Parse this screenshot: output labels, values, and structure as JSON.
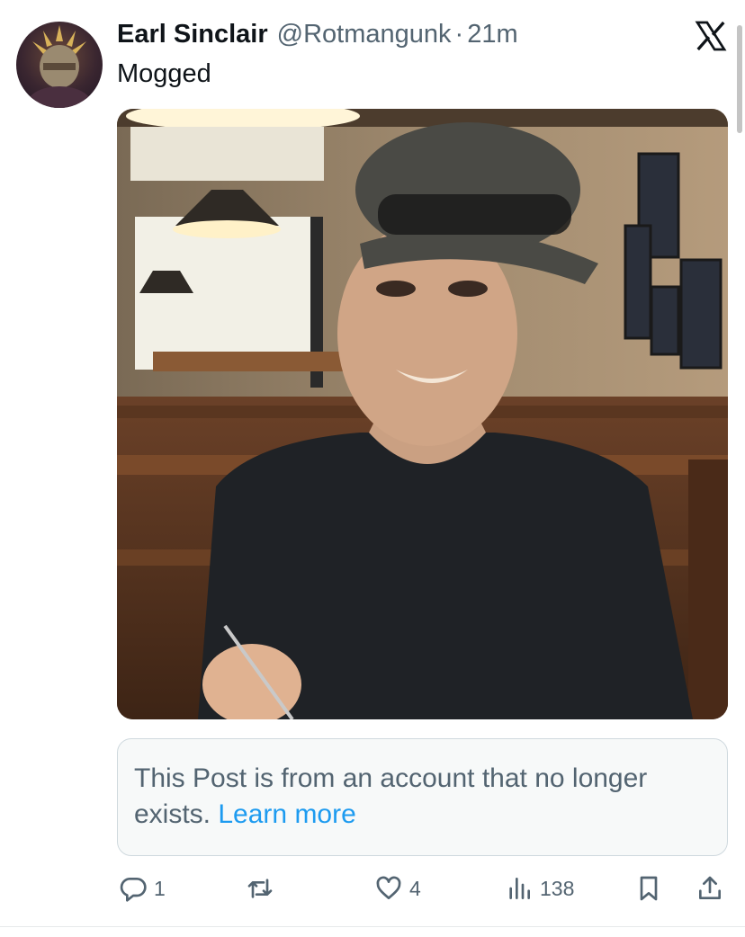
{
  "post": {
    "display_name": "Earl Sinclair",
    "handle": "@Rotmangunk",
    "separator": "·",
    "time": "21m",
    "text": "Mogged",
    "platform_icon": "x-logo-icon",
    "avatar_icon": "roman-helmet-avatar"
  },
  "notice": {
    "text": "This Post is from an account that no longer exists.",
    "link": "Learn more"
  },
  "actions": {
    "reply_count": "1",
    "repost_count": "",
    "like_count": "4",
    "views_count": "138",
    "icons": [
      "reply-icon",
      "repost-icon",
      "like-icon",
      "views-icon",
      "bookmark-icon",
      "share-icon"
    ]
  },
  "colors": {
    "text_primary": "#0f1419",
    "text_secondary": "#536471",
    "link": "#1d9bf0",
    "border": "#cfd9de",
    "notice_bg": "#f7f9f9"
  }
}
